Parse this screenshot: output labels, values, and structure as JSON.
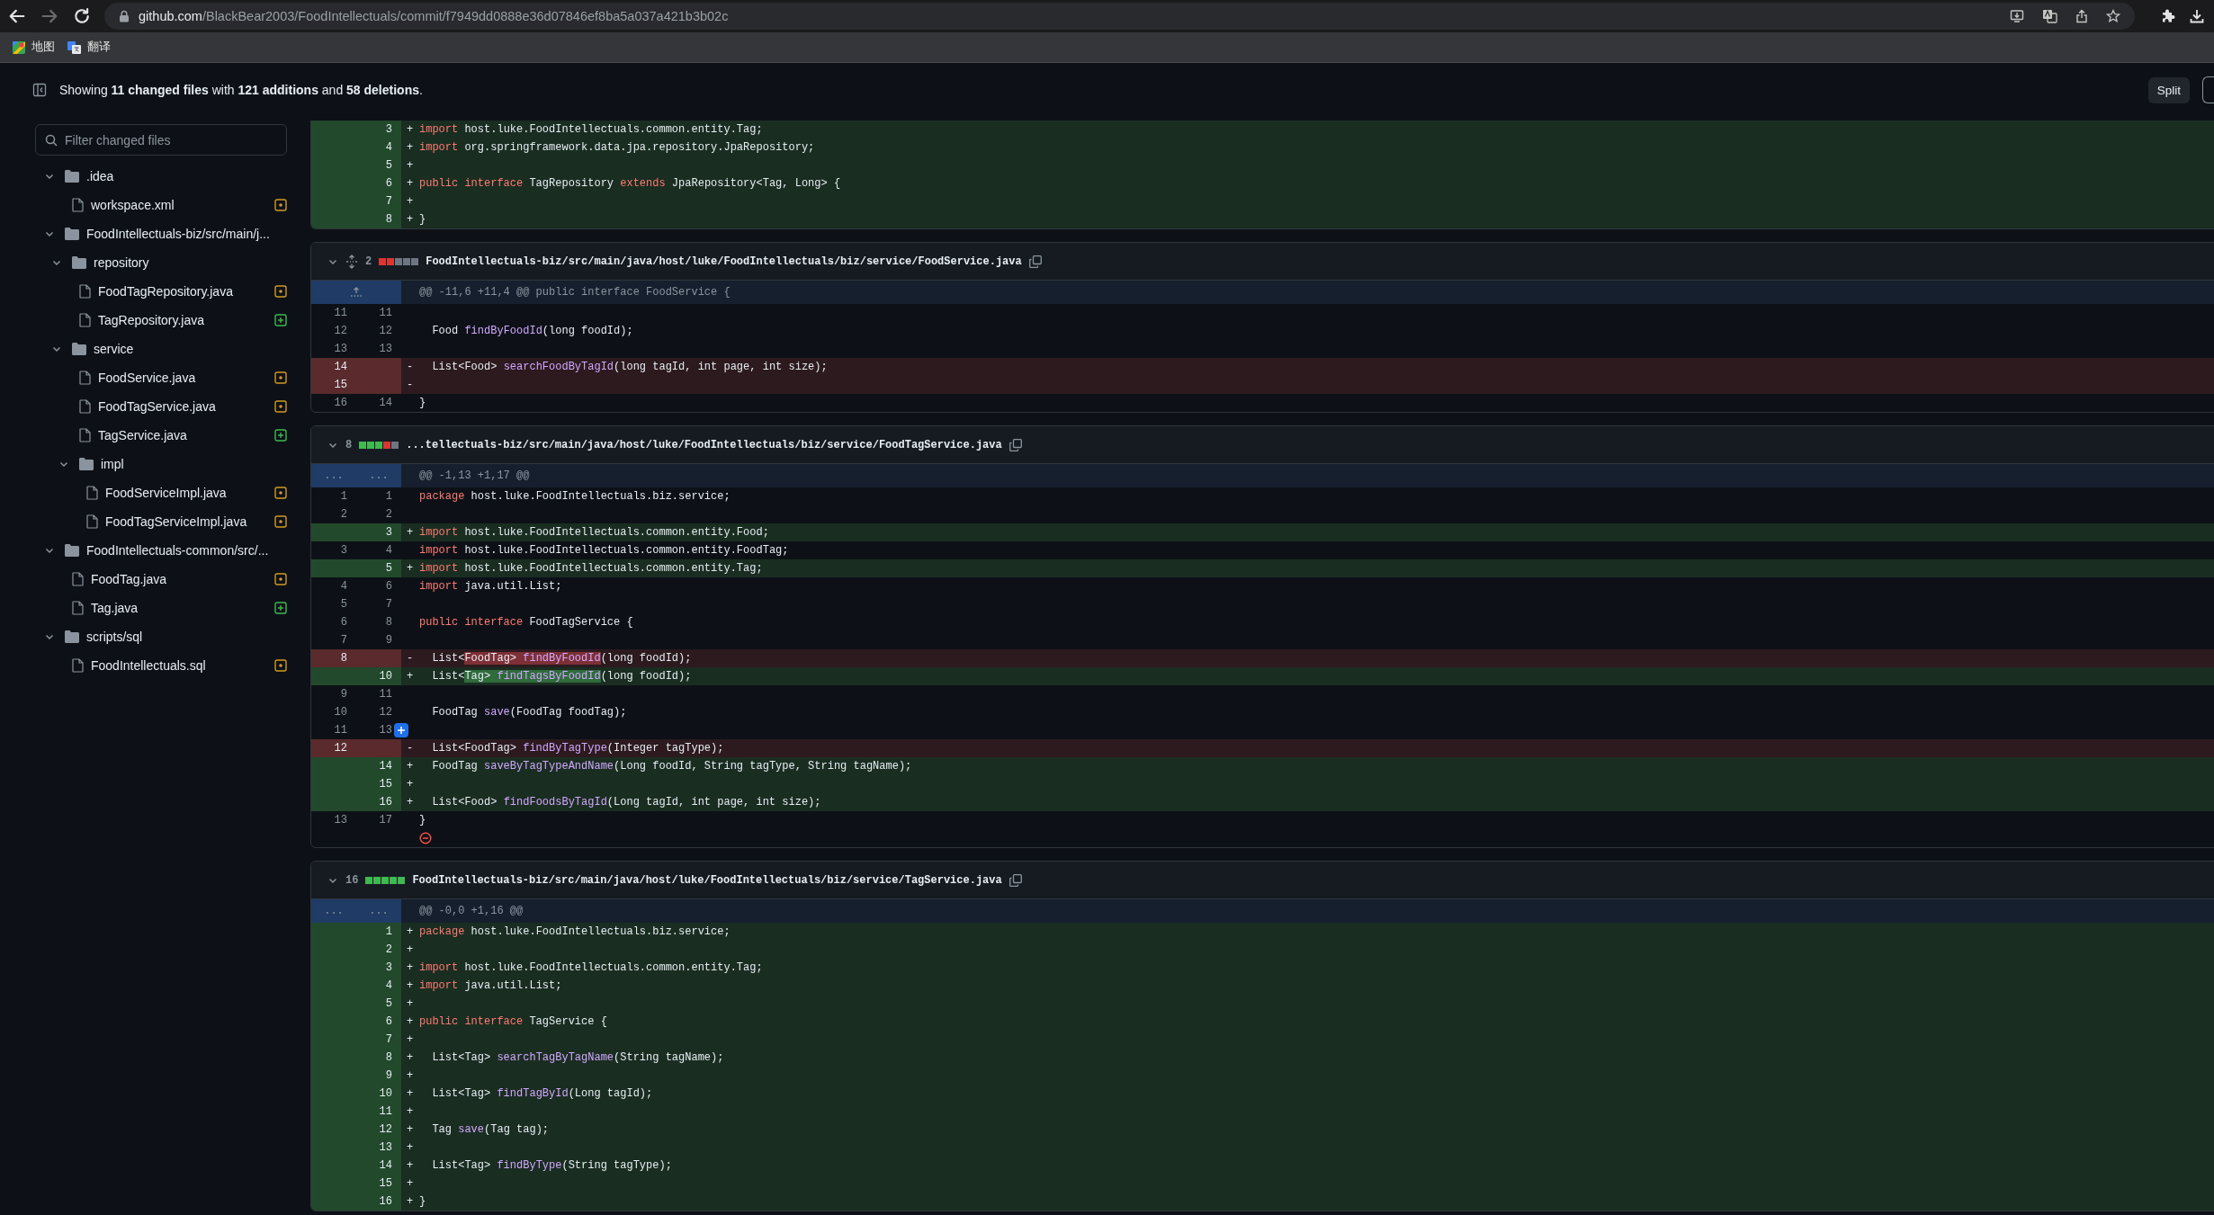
{
  "browser": {
    "nav": [
      {
        "kind": "back",
        "disabled": false
      },
      {
        "kind": "forward",
        "disabled": true
      },
      {
        "kind": "reload",
        "disabled": false
      }
    ],
    "url": {
      "host": "github.com",
      "path": "/BlackBear2003/FoodIntellectuals/commit/f7949dd0888e36d07846ef8ba5a037a421b3b02c"
    },
    "bookmarks": [
      {
        "label": "地图",
        "kind": "maps"
      },
      {
        "label": "翻译",
        "kind": "translate"
      }
    ]
  },
  "summary": "Showing **11 changed files** with **121 additions** and **58 deletions**.",
  "view_toggle": {
    "label": "Split"
  },
  "sidebar": {
    "filter": {
      "placeholder": "Filter changed files"
    },
    "tree": [
      {
        "name": ".idea",
        "kind": "folder",
        "expanded": true,
        "children": [
          {
            "name": "workspace.xml",
            "kind": "file",
            "added": false
          }
        ]
      },
      {
        "name": "FoodIntellectuals-biz/src/main/j...",
        "kind": "folder",
        "expanded": true,
        "children": [
          {
            "name": "repository",
            "kind": "folder",
            "expanded": true,
            "children": [
              {
                "name": "FoodTagRepository.java",
                "kind": "file",
                "added": false
              },
              {
                "name": "TagRepository.java",
                "kind": "file",
                "added": true
              }
            ]
          },
          {
            "name": "service",
            "kind": "folder",
            "expanded": true,
            "children": [
              {
                "name": "FoodService.java",
                "kind": "file",
                "added": false
              },
              {
                "name": "FoodTagService.java",
                "kind": "file",
                "added": false
              },
              {
                "name": "TagService.java",
                "kind": "file",
                "added": true
              },
              {
                "name": "impl",
                "kind": "folder",
                "expanded": true,
                "children": [
                  {
                    "name": "FoodServiceImpl.java",
                    "kind": "file",
                    "added": false
                  },
                  {
                    "name": "FoodTagServiceImpl.java",
                    "kind": "file",
                    "added": false
                  }
                ]
              }
            ]
          }
        ]
      },
      {
        "name": "FoodIntellectuals-common/src/...",
        "kind": "folder",
        "expanded": true,
        "children": [
          {
            "name": "FoodTag.java",
            "kind": "file",
            "added": false
          },
          {
            "name": "Tag.java",
            "kind": "file",
            "added": true
          }
        ]
      },
      {
        "name": "scripts/sql",
        "kind": "folder",
        "expanded": true,
        "children": [
          {
            "name": "FoodIntellectuals.sql",
            "kind": "file",
            "added": false
          }
        ]
      }
    ]
  },
  "files": [
    {
      "no_newline_mark": false,
      "lines": [
        {
          "kind": "add",
          "new": "3",
          "sign": "+",
          "code": [
            {
              "kind": "keyword",
              "text": "import"
            },
            {
              "kind": "plain",
              "text": " host.luke.FoodIntellectuals.common.entity.Tag;"
            }
          ]
        },
        {
          "kind": "add",
          "new": "4",
          "sign": "+",
          "code": [
            {
              "kind": "keyword",
              "text": "import"
            },
            {
              "kind": "plain",
              "text": " org.springframework.data.jpa.repository.JpaRepository;"
            }
          ]
        },
        {
          "kind": "add",
          "new": "5",
          "sign": "+"
        },
        {
          "kind": "add",
          "new": "6",
          "sign": "+",
          "code": [
            {
              "kind": "keyword",
              "text": "public interface"
            },
            {
              "kind": "plain",
              "text": " TagRepository "
            },
            {
              "kind": "keyword",
              "text": "extends"
            },
            {
              "kind": "plain",
              "text": " JpaRepository<Tag, Long> {"
            }
          ]
        },
        {
          "kind": "add",
          "new": "7",
          "sign": "+"
        },
        {
          "kind": "add",
          "new": "8",
          "sign": "+",
          "code": [
            {
              "kind": "plain",
              "text": "}"
            }
          ]
        }
      ]
    },
    {
      "header": {
        "count": "2",
        "unfold_icon": true,
        "diffstat": [
          {
            "kind": "del"
          },
          {
            "kind": "del"
          },
          {
            "kind": "neutral"
          },
          {
            "kind": "neutral"
          },
          {
            "kind": "neutral"
          }
        ],
        "path": "FoodIntellectuals-biz/src/main/java/host/luke/FoodIntellectuals/biz/service/FoodService.java"
      },
      "no_newline_mark": false,
      "lines": [
        {
          "kind": "hunk",
          "expand_icon": true,
          "text": "@@ -11,6 +11,4 @@ public interface FoodService {"
        },
        {
          "kind": "ctx",
          "old": "11",
          "new": "11"
        },
        {
          "kind": "ctx",
          "old": "12",
          "new": "12",
          "code": [
            {
              "kind": "plain",
              "text": "  Food "
            },
            {
              "kind": "function",
              "text": "findByFoodId"
            },
            {
              "kind": "plain",
              "text": "(long foodId);"
            }
          ]
        },
        {
          "kind": "ctx",
          "old": "13",
          "new": "13"
        },
        {
          "kind": "del",
          "old": "14",
          "sign": "-",
          "code": [
            {
              "kind": "plain",
              "text": "  List<Food> "
            },
            {
              "kind": "function",
              "text": "searchFoodByTagId"
            },
            {
              "kind": "plain",
              "text": "(long tagId, int page, int size);"
            }
          ]
        },
        {
          "kind": "del",
          "old": "15",
          "sign": "-"
        },
        {
          "kind": "ctx",
          "old": "16",
          "new": "14",
          "code": [
            {
              "kind": "plain",
              "text": "}"
            }
          ]
        }
      ]
    },
    {
      "header": {
        "count": "8",
        "unfold_icon": false,
        "diffstat": [
          {
            "kind": "add"
          },
          {
            "kind": "add"
          },
          {
            "kind": "add"
          },
          {
            "kind": "del"
          },
          {
            "kind": "neutral"
          }
        ],
        "path": "...tellectuals-biz/src/main/java/host/luke/FoodIntellectuals/biz/service/FoodTagService.java"
      },
      "no_newline_mark": true,
      "lines": [
        {
          "kind": "hunk",
          "expand_icon": false,
          "old": "...",
          "new": "...",
          "text": "@@ -1,13 +1,17 @@"
        },
        {
          "kind": "ctx",
          "old": "1",
          "new": "1",
          "code": [
            {
              "kind": "keyword",
              "text": "package"
            },
            {
              "kind": "plain",
              "text": " host.luke.FoodIntellectuals.biz.service;"
            }
          ]
        },
        {
          "kind": "ctx",
          "old": "2",
          "new": "2"
        },
        {
          "kind": "add",
          "new": "3",
          "sign": "+",
          "code": [
            {
              "kind": "keyword",
              "text": "import"
            },
            {
              "kind": "plain",
              "text": " host.luke.FoodIntellectuals.common.entity.Food;"
            }
          ]
        },
        {
          "kind": "ctx",
          "old": "3",
          "new": "4",
          "code": [
            {
              "kind": "keyword",
              "text": "import"
            },
            {
              "kind": "plain",
              "text": " host.luke.FoodIntellectuals.common.entity.FoodTag;"
            }
          ]
        },
        {
          "kind": "add",
          "new": "5",
          "sign": "+",
          "code": [
            {
              "kind": "keyword",
              "text": "import"
            },
            {
              "kind": "plain",
              "text": " host.luke.FoodIntellectuals.common.entity.Tag;"
            }
          ]
        },
        {
          "kind": "ctx",
          "old": "4",
          "new": "6",
          "code": [
            {
              "kind": "keyword",
              "text": "import"
            },
            {
              "kind": "plain",
              "text": " java.util.List;"
            }
          ]
        },
        {
          "kind": "ctx",
          "old": "5",
          "new": "7"
        },
        {
          "kind": "ctx",
          "old": "6",
          "new": "8",
          "code": [
            {
              "kind": "keyword",
              "text": "public interface"
            },
            {
              "kind": "plain",
              "text": " FoodTagService {"
            }
          ]
        },
        {
          "kind": "ctx",
          "old": "7",
          "new": "9"
        },
        {
          "kind": "del",
          "old": "8",
          "sign": "-",
          "code": [
            {
              "kind": "plain",
              "text": "  List<",
              "changed": false
            },
            {
              "kind": "plain",
              "text": "FoodTag> ",
              "changed": true
            },
            {
              "kind": "function",
              "text": "findByFoodId",
              "changed": true
            },
            {
              "kind": "plain",
              "text": "(long foodId);",
              "changed": false
            }
          ]
        },
        {
          "kind": "add",
          "new": "10",
          "sign": "+",
          "code": [
            {
              "kind": "plain",
              "text": "  List<",
              "changed": false
            },
            {
              "kind": "plain",
              "text": "Tag> ",
              "changed": true
            },
            {
              "kind": "function",
              "text": "findTagsByFoodId",
              "changed": true
            },
            {
              "kind": "plain",
              "text": "(long foodId);",
              "changed": false
            }
          ]
        },
        {
          "kind": "ctx",
          "old": "9",
          "new": "11"
        },
        {
          "kind": "ctx",
          "old": "10",
          "new": "12",
          "code": [
            {
              "kind": "plain",
              "text": "  FoodTag "
            },
            {
              "kind": "function",
              "text": "save"
            },
            {
              "kind": "plain",
              "text": "(FoodTag foodTag);"
            }
          ]
        },
        {
          "kind": "ctx",
          "old": "11",
          "new": "13",
          "add_comment_button": true
        },
        {
          "kind": "del",
          "old": "12",
          "sign": "-",
          "code": [
            {
              "kind": "plain",
              "text": "  List<FoodTag> "
            },
            {
              "kind": "function",
              "text": "findByTagType"
            },
            {
              "kind": "plain",
              "text": "(Integer tagType);"
            }
          ]
        },
        {
          "kind": "add",
          "new": "14",
          "sign": "+",
          "code": [
            {
              "kind": "plain",
              "text": "  FoodTag "
            },
            {
              "kind": "function",
              "text": "saveByTagTypeAndName"
            },
            {
              "kind": "plain",
              "text": "(Long foodId, String tagType, String tagName);"
            }
          ]
        },
        {
          "kind": "add",
          "new": "15",
          "sign": "+"
        },
        {
          "kind": "add",
          "new": "16",
          "sign": "+",
          "code": [
            {
              "kind": "plain",
              "text": "  List<Food> "
            },
            {
              "kind": "function",
              "text": "findFoodsByTagId"
            },
            {
              "kind": "plain",
              "text": "(Long tagId, int page, int size);"
            }
          ]
        },
        {
          "kind": "ctx",
          "old": "13",
          "new": "17",
          "code": [
            {
              "kind": "plain",
              "text": "}"
            }
          ]
        }
      ]
    },
    {
      "header": {
        "count": "16",
        "unfold_icon": false,
        "diffstat": [
          {
            "kind": "add"
          },
          {
            "kind": "add"
          },
          {
            "kind": "add"
          },
          {
            "kind": "add"
          },
          {
            "kind": "add"
          }
        ],
        "path": "FoodIntellectuals-biz/src/main/java/host/luke/FoodIntellectuals/biz/service/TagService.java"
      },
      "no_newline_mark": false,
      "lines": [
        {
          "kind": "hunk",
          "expand_icon": false,
          "old": "...",
          "new": "...",
          "text": "@@ -0,0 +1,16 @@"
        },
        {
          "kind": "add",
          "new": "1",
          "sign": "+",
          "code": [
            {
              "kind": "keyword",
              "text": "package"
            },
            {
              "kind": "plain",
              "text": " host.luke.FoodIntellectuals.biz.service;"
            }
          ]
        },
        {
          "kind": "add",
          "new": "2",
          "sign": "+"
        },
        {
          "kind": "add",
          "new": "3",
          "sign": "+",
          "code": [
            {
              "kind": "keyword",
              "text": "import"
            },
            {
              "kind": "plain",
              "text": " host.luke.FoodIntellectuals.common.entity.Tag;"
            }
          ]
        },
        {
          "kind": "add",
          "new": "4",
          "sign": "+",
          "code": [
            {
              "kind": "keyword",
              "text": "import"
            },
            {
              "kind": "plain",
              "text": " java.util.List;"
            }
          ]
        },
        {
          "kind": "add",
          "new": "5",
          "sign": "+"
        },
        {
          "kind": "add",
          "new": "6",
          "sign": "+",
          "code": [
            {
              "kind": "keyword",
              "text": "public interface"
            },
            {
              "kind": "plain",
              "text": " TagService {"
            }
          ]
        },
        {
          "kind": "add",
          "new": "7",
          "sign": "+"
        },
        {
          "kind": "add",
          "new": "8",
          "sign": "+",
          "code": [
            {
              "kind": "plain",
              "text": "  List<Tag> "
            },
            {
              "kind": "function",
              "text": "searchTagByTagName"
            },
            {
              "kind": "plain",
              "text": "(String tagName);"
            }
          ]
        },
        {
          "kind": "add",
          "new": "9",
          "sign": "+"
        },
        {
          "kind": "add",
          "new": "10",
          "sign": "+",
          "code": [
            {
              "kind": "plain",
              "text": "  List<Tag> "
            },
            {
              "kind": "function",
              "text": "findTagById"
            },
            {
              "kind": "plain",
              "text": "(Long tagId);"
            }
          ]
        },
        {
          "kind": "add",
          "new": "11",
          "sign": "+"
        },
        {
          "kind": "add",
          "new": "12",
          "sign": "+",
          "code": [
            {
              "kind": "plain",
              "text": "  Tag "
            },
            {
              "kind": "function",
              "text": "save"
            },
            {
              "kind": "plain",
              "text": "(Tag tag);"
            }
          ]
        },
        {
          "kind": "add",
          "new": "13",
          "sign": "+"
        },
        {
          "kind": "add",
          "new": "14",
          "sign": "+",
          "code": [
            {
              "kind": "plain",
              "text": "  List<Tag> "
            },
            {
              "kind": "function",
              "text": "findByType"
            },
            {
              "kind": "plain",
              "text": "(String tagType);"
            }
          ]
        },
        {
          "kind": "add",
          "new": "15",
          "sign": "+"
        },
        {
          "kind": "add",
          "new": "16",
          "sign": "+",
          "code": [
            {
              "kind": "plain",
              "text": "}"
            }
          ]
        }
      ]
    }
  ]
}
